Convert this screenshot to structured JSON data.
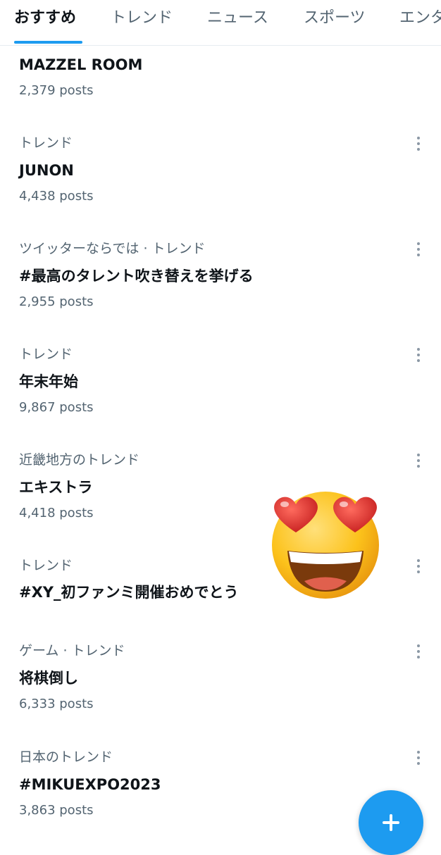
{
  "tabs": [
    {
      "label": "おすすめ",
      "active": true
    },
    {
      "label": "トレンド",
      "active": false
    },
    {
      "label": "ニュース",
      "active": false
    },
    {
      "label": "スポーツ",
      "active": false
    },
    {
      "label": "エンタ",
      "active": false
    }
  ],
  "trends": [
    {
      "context": "",
      "title": "MAZZEL ROOM",
      "count": "2,379 posts"
    },
    {
      "context": "トレンド",
      "title": "JUNON",
      "count": "4,438 posts"
    },
    {
      "context": "ツイッターならでは · トレンド",
      "title": "#最高のタレント吹き替えを挙げる",
      "count": "2,955 posts"
    },
    {
      "context": "トレンド",
      "title": "年末年始",
      "count": "9,867 posts"
    },
    {
      "context": "近畿地方のトレンド",
      "title": "エキストラ",
      "count": "4,418 posts"
    },
    {
      "context": "トレンド",
      "title": "#XY_初ファンミ開催おめでとう",
      "count": ""
    },
    {
      "context": "ゲーム · トレンド",
      "title": "将棋倒し",
      "count": "6,333 posts"
    },
    {
      "context": "日本のトレンド",
      "title": "#MIKUEXPO2023",
      "count": "3,863 posts"
    }
  ],
  "overlay": {
    "emoji_name": "smiling-face-with-heart-eyes"
  },
  "fab": {
    "icon": "plus-icon"
  },
  "colors": {
    "accent": "#1d9bf0",
    "text": "#0f1419",
    "secondary": "#536471"
  }
}
